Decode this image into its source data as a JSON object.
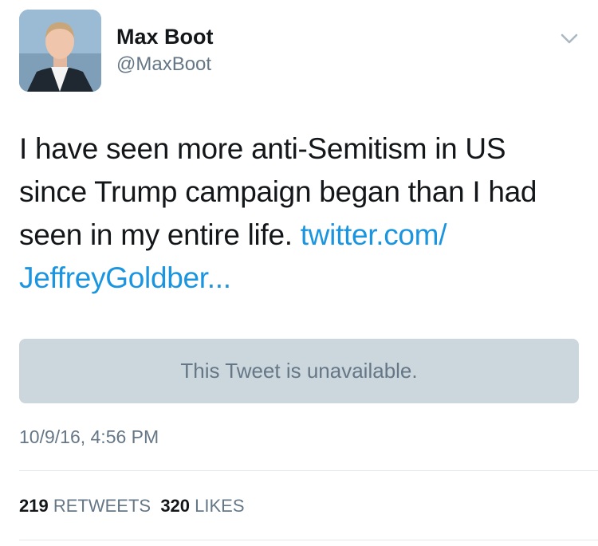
{
  "author": {
    "name": "Max Boot",
    "handle": "@MaxBoot",
    "avatar_icon": "profile-photo"
  },
  "menu_icon": "chevron-down-icon",
  "tweet": {
    "text": "I have seen more anti-Semitism in US since Trump campaign began than I had seen in my entire life. ",
    "link_line1": "twitter.com/",
    "link_line2": "JeffreyGoldber..."
  },
  "quoted_tweet": {
    "message": "This Tweet is unavailable."
  },
  "timestamp": "10/9/16, 4:56 PM",
  "stats": {
    "retweets_count": "219",
    "retweets_label": "RETWEETS",
    "likes_count": "320",
    "likes_label": "LIKES"
  },
  "colors": {
    "link": "#1b95e0",
    "secondary_text": "#657786",
    "quote_bg": "#ccd6dd",
    "divider": "#e1e8ed"
  }
}
